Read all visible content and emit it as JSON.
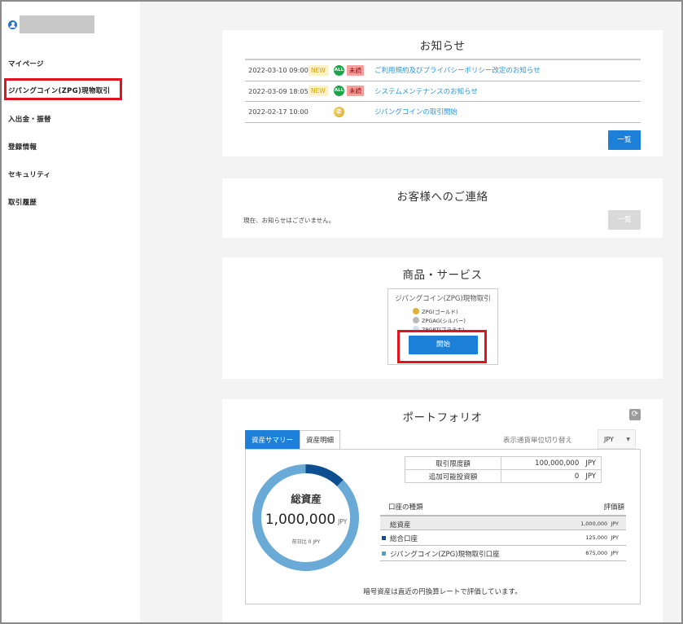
{
  "sidebar": {
    "items": [
      {
        "label": "マイページ"
      },
      {
        "label": "ジパングコイン(ZPG)現物取引"
      },
      {
        "label": "入出金・振替"
      },
      {
        "label": "登録情報"
      },
      {
        "label": "セキュリティ"
      },
      {
        "label": "取引履歴"
      }
    ]
  },
  "notices": {
    "title": "お知らせ",
    "rows": [
      {
        "date": "2022-03-10 09:00",
        "new": "NEW",
        "all": "ALL",
        "unread": "未読",
        "text": "ご利用規約及びプライバシーポリシー改定のお知らせ"
      },
      {
        "date": "2022-03-09 18:05",
        "new": "NEW",
        "all": "ALL",
        "unread": "未読",
        "text": "システムメンテナンスのお知らせ"
      },
      {
        "date": "2022-02-17 10:00",
        "coin": "Z",
        "text": "ジパングコインの取引開始"
      }
    ],
    "list_button": "一覧"
  },
  "contact": {
    "title": "お客様へのご連絡",
    "message": "現在、お知らせはございません。",
    "list_button": "一覧"
  },
  "products": {
    "title": "商品・サービス",
    "product_name": "ジパングコイン(ZPG)現物取引",
    "items": [
      {
        "label": "ZPG(ゴールド)"
      },
      {
        "label": "ZPGAG(シルバー)"
      },
      {
        "label": "ZPGPT(プラチナ)"
      }
    ],
    "start_button": "開始"
  },
  "portfolio": {
    "title": "ポートフォリオ",
    "tabs": [
      {
        "label": "資産サマリー"
      },
      {
        "label": "資産明細"
      }
    ],
    "currency_label": "表示通貨単位切り替え",
    "currency_value": "JPY",
    "limits": [
      {
        "key": "取引限度額",
        "value": "100,000,000",
        "unit": "JPY"
      },
      {
        "key": "追加可能投資額",
        "value": "0",
        "unit": "JPY"
      }
    ],
    "donut": {
      "label": "総資産",
      "value": "1,000,000",
      "unit": "JPY",
      "sub": "前日比 0 JPY",
      "segments": [
        {
          "name": "総合口座",
          "value": 125000,
          "color": "#0d4f91"
        },
        {
          "name": "ジパングコイン(ZPG)現物取引口座",
          "value": 875000,
          "color": "#6aaad6"
        }
      ]
    },
    "accounts_header": {
      "type": "口座の種類",
      "value": "評価額"
    },
    "accounts": [
      {
        "name": "総資産",
        "amount": "1,000,000",
        "unit": "JPY"
      },
      {
        "name": "総合口座",
        "amount": "125,000",
        "unit": "JPY",
        "color": "#0d4f91"
      },
      {
        "name": "ジパングコイン(ZPG)現物取引口座",
        "amount": "875,000",
        "unit": "JPY",
        "color": "#4aa3c9"
      }
    ],
    "note": "暗号資産は直近の円換算レートで評価しています。"
  },
  "colors": {
    "accent": "#1c7fd8",
    "highlight": "#e0141e",
    "link": "#2a97d8"
  }
}
